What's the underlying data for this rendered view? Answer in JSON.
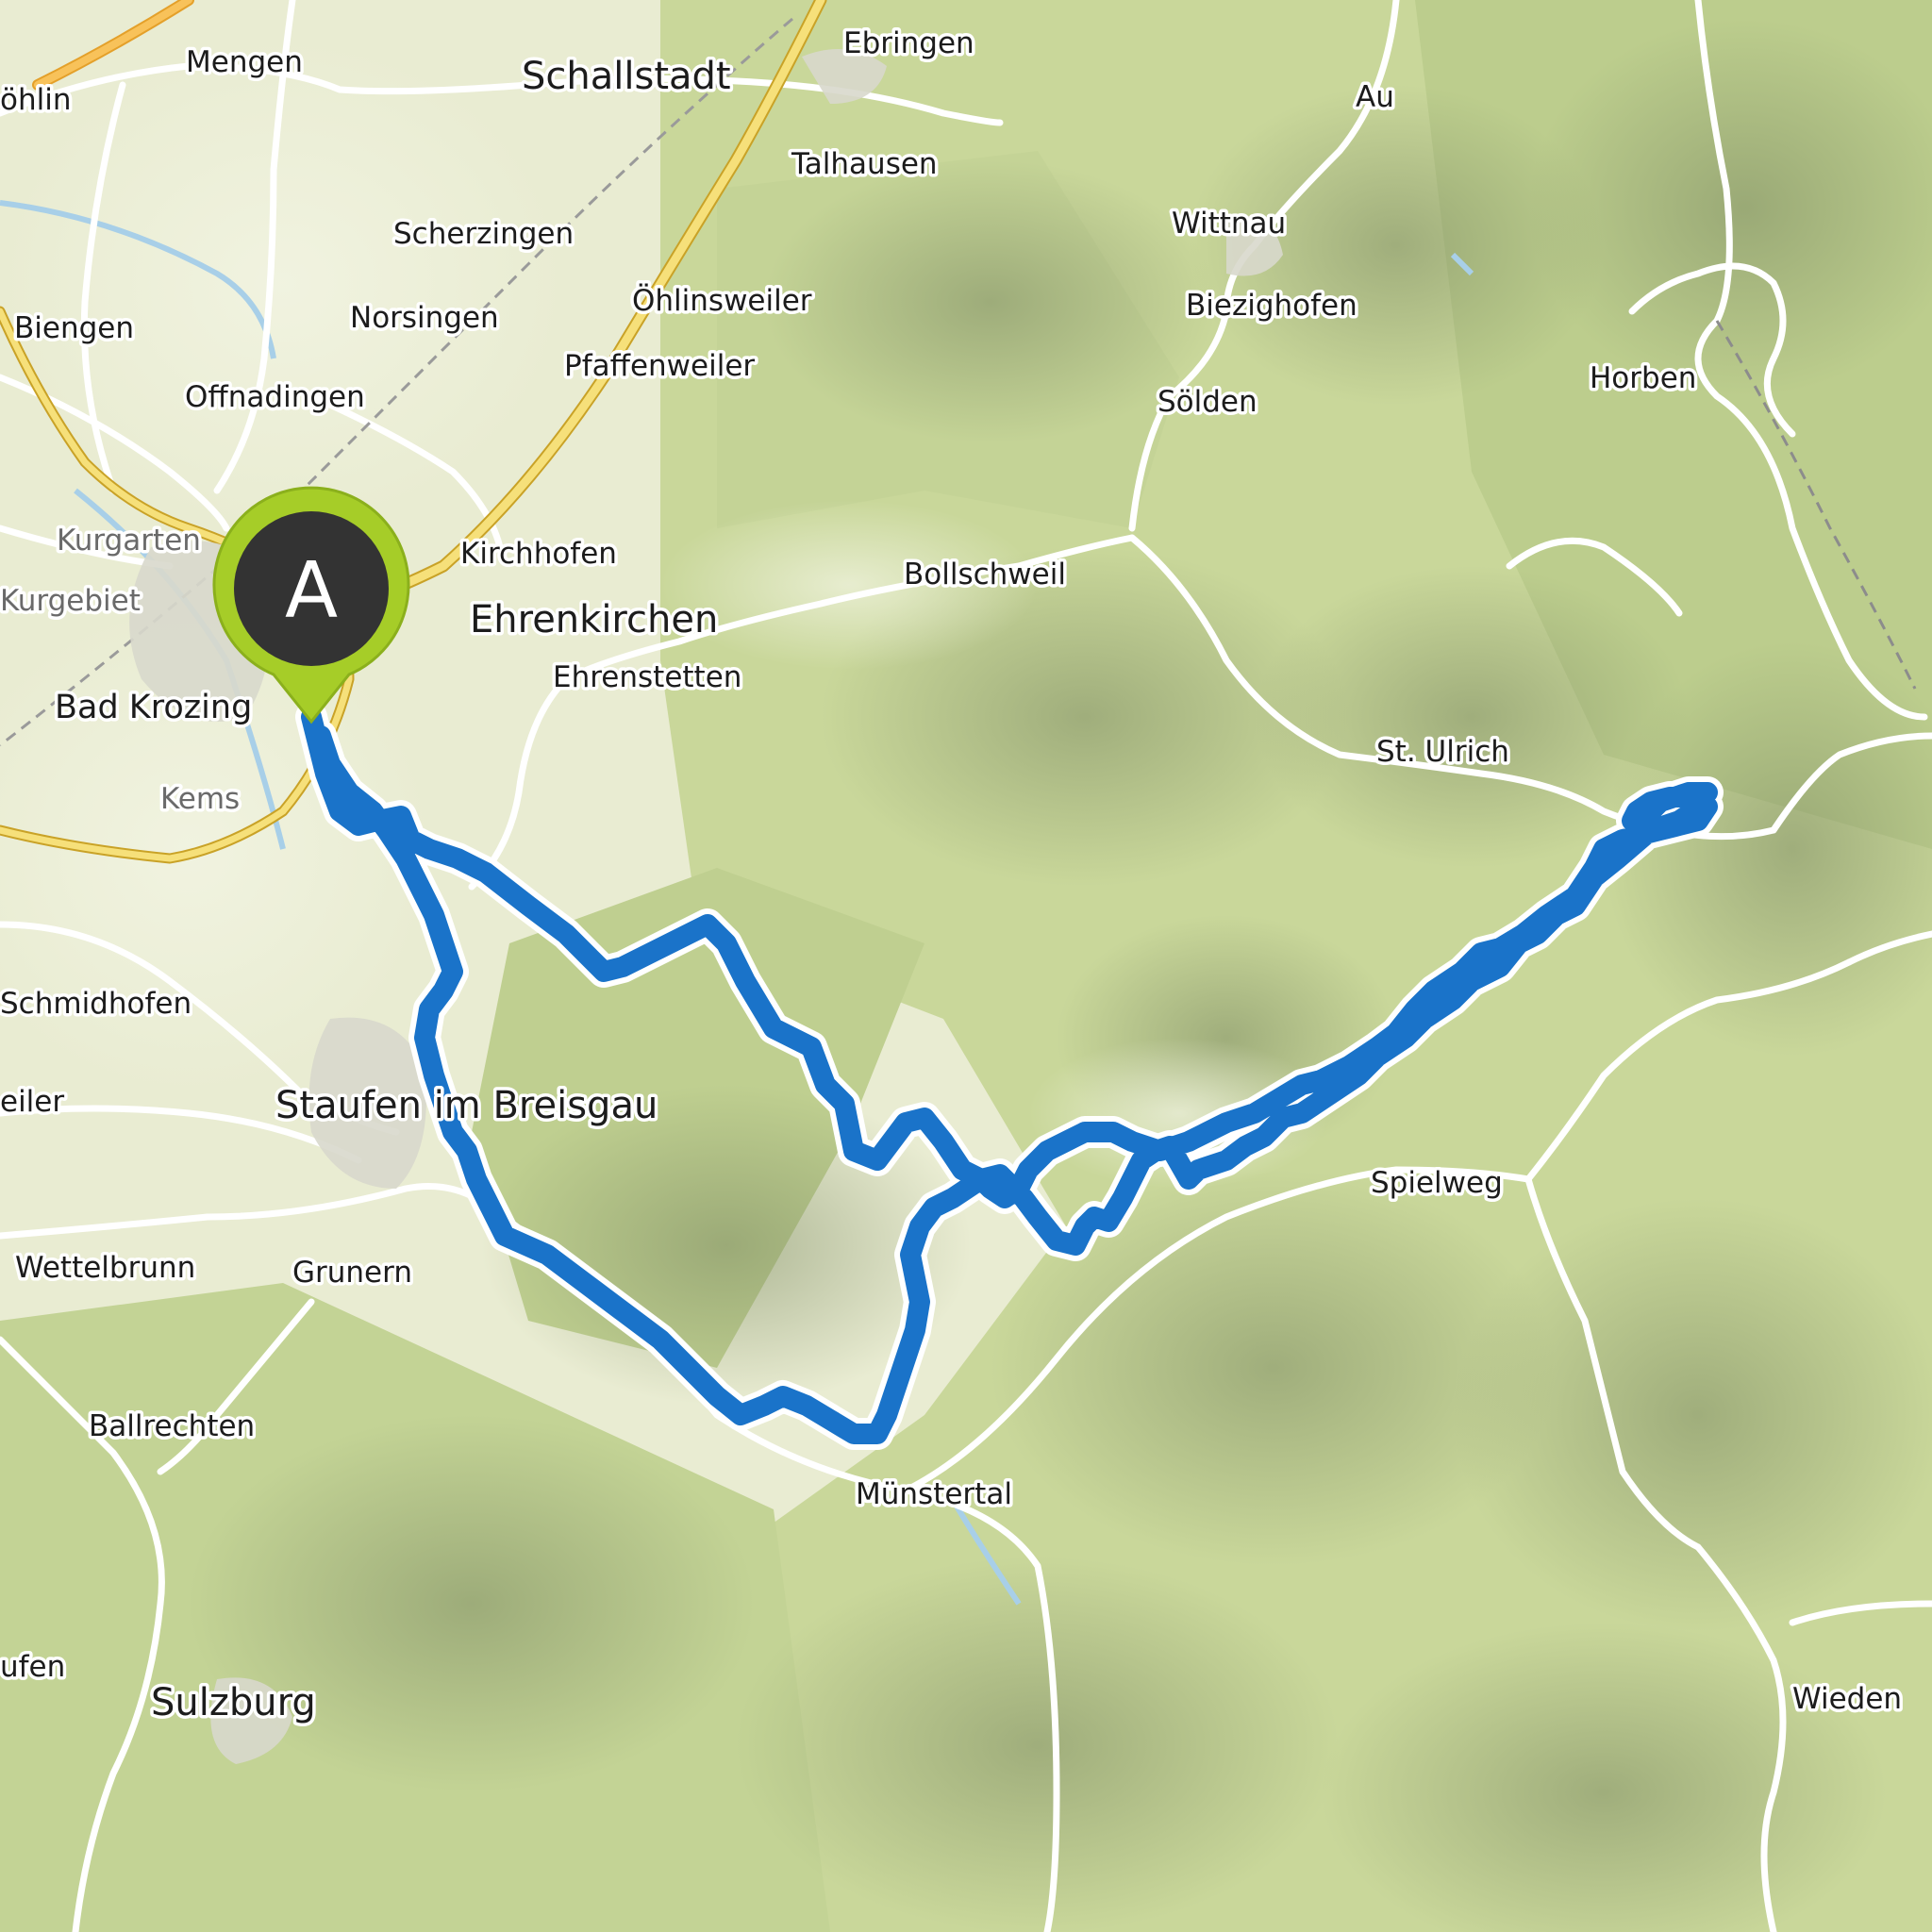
{
  "map": {
    "colors": {
      "land": "#e9ecd2",
      "forest": "#c9d79a",
      "hill_shadow": "#8e9c73",
      "road_major": "#f6e07a",
      "road_minor": "#ffffff",
      "water": "#a8cfe8",
      "route": "#1a73c9",
      "route_outline": "#ffffff",
      "marker_body": "#333333",
      "marker_ring": "#a6cd28"
    },
    "start_marker": {
      "letter": "A",
      "icon": "map-pin-icon"
    },
    "places": {
      "ohlin": "öhlin",
      "mengen": "Mengen",
      "schallstadt": "Schallstadt",
      "ebringen": "Ebringen",
      "au": "Au",
      "talhausen": "Talhausen",
      "scherzingen": "Scherzingen",
      "wittnau": "Wittnau",
      "biengen": "Biengen",
      "norsingen": "Norsingen",
      "ohlinsweiler": "Öhlinsweiler",
      "biezighofen": "Biezighofen",
      "pfaffenweiler": "Pfaffenweiler",
      "offnadingen": "Offnadingen",
      "horben": "Horben",
      "solden": "Sölden",
      "kurgarten": "Kurgarten",
      "kirchhofen": "Kirchhofen",
      "bollschweil": "Bollschweil",
      "kurgebiet": "Kurgebiet",
      "ehrenkirchen": "Ehrenkirchen",
      "ehrenstetten": "Ehrenstetten",
      "bad_krozingen": "Bad Krozing",
      "st_ulrich": "St. Ulrich",
      "kems": "Kems",
      "schmidhofen": "Schmidhofen",
      "eiler": "eiler",
      "staufen": "Staufen im Breisgau",
      "spielweg": "Spielweg",
      "wettelbrunn": "Wettelbrunn",
      "grunern": "Grunern",
      "ballrechten": "Ballrechten",
      "munstertal": "Münstertal",
      "ufen": "ufen",
      "sulzburg": "Sulzburg",
      "wieden": "Wieden"
    }
  }
}
